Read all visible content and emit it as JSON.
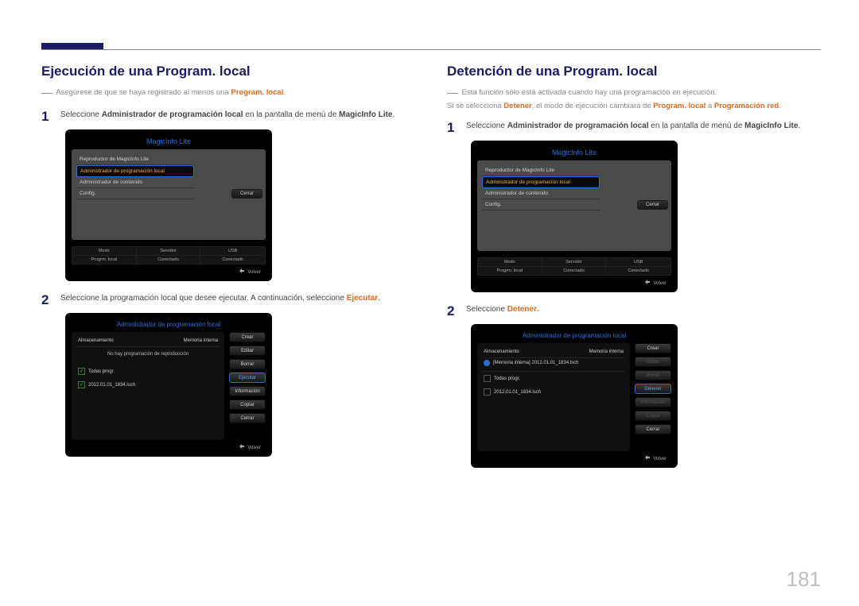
{
  "page_number": "181",
  "left": {
    "heading": "Ejecución de una Program. local",
    "note_pre": "Asegúrese de que se haya registrado al menos una ",
    "note_em": "Program. local",
    "note_post": ".",
    "step1_pre": "Seleccione ",
    "step1_em1": "Administrador de programación local",
    "step1_mid": " en la pantalla de menú de ",
    "step1_em2": "MagicInfo Lite",
    "step1_post": ".",
    "panel_menu": {
      "title": "MagicInfo Lite",
      "items": [
        "Reproductor de MagicInfo Lite",
        "Administrador de programación local",
        "Administrador de contenido",
        "Config."
      ],
      "close": "Cerrar",
      "status_headers": [
        "Modo",
        "Servidor",
        "USB"
      ],
      "status_values": [
        "Progrm. local",
        "Conectado",
        "Conectado"
      ],
      "back": "Volver"
    },
    "step2_pre": "Seleccione la programación local que desee ejecutar. A continuación, seleccione ",
    "step2_em": "Ejecutar",
    "step2_post": ".",
    "panel_admin": {
      "title": "Administrador de programación local",
      "storage_label": "Almacenamiento",
      "storage_value": "Memoria interna",
      "msg": "No hay programación de reproducción",
      "all_prog": "Todas progr.",
      "file": "2012.01.01_1834.lsch",
      "buttons": [
        "Crear",
        "Editar",
        "Borrar",
        "Ejecutar",
        "Información",
        "Copiar",
        "Cerrar"
      ],
      "primary_index": 3,
      "back": "Volver"
    }
  },
  "right": {
    "heading": "Detención de una Program. local",
    "note_line1": "Esta función sólo está activada cuando hay una programación en ejecución.",
    "note2_pre": "Si se selecciona ",
    "note2_em1": "Detener",
    "note2_mid": ", el modo de ejecución cambiará de ",
    "note2_em2": "Program. local",
    "note2_mid2": " a ",
    "note2_em3": "Programación red",
    "note2_post": ".",
    "step1_pre": "Seleccione ",
    "step1_em1": "Administrador de programación local",
    "step1_mid": " en la pantalla de menú de ",
    "step1_em2": "MagicInfo Lite",
    "step1_post": ".",
    "panel_menu": {
      "title": "MagicInfo Lite",
      "items": [
        "Reproductor de MagicInfo Lite",
        "Administrador de programación local",
        "Administrador de contenido",
        "Config."
      ],
      "close": "Cerrar",
      "status_headers": [
        "Modo",
        "Servidor",
        "USB"
      ],
      "status_values": [
        "Progrm. local",
        "Conectado",
        "Conectado"
      ],
      "back": "Volver"
    },
    "step2_pre": "Seleccione ",
    "step2_em": "Detener",
    "step2_post": ".",
    "panel_admin": {
      "title": "Administrador de programación local",
      "storage_label": "Almacenamiento",
      "storage_value": "Memoria interna",
      "playing": "[Memoria interna] 2012.01.01_1834.lsch",
      "all_prog": "Todas progr.",
      "file": "2012.01.01_1834.lsch",
      "buttons": [
        "Crear",
        "Editar",
        "Borrar",
        "Detener",
        "Información",
        "Copiar",
        "Cerrar"
      ],
      "primary_index": 3,
      "disabled": [
        1,
        2,
        4,
        5
      ],
      "back": "Volver"
    }
  }
}
